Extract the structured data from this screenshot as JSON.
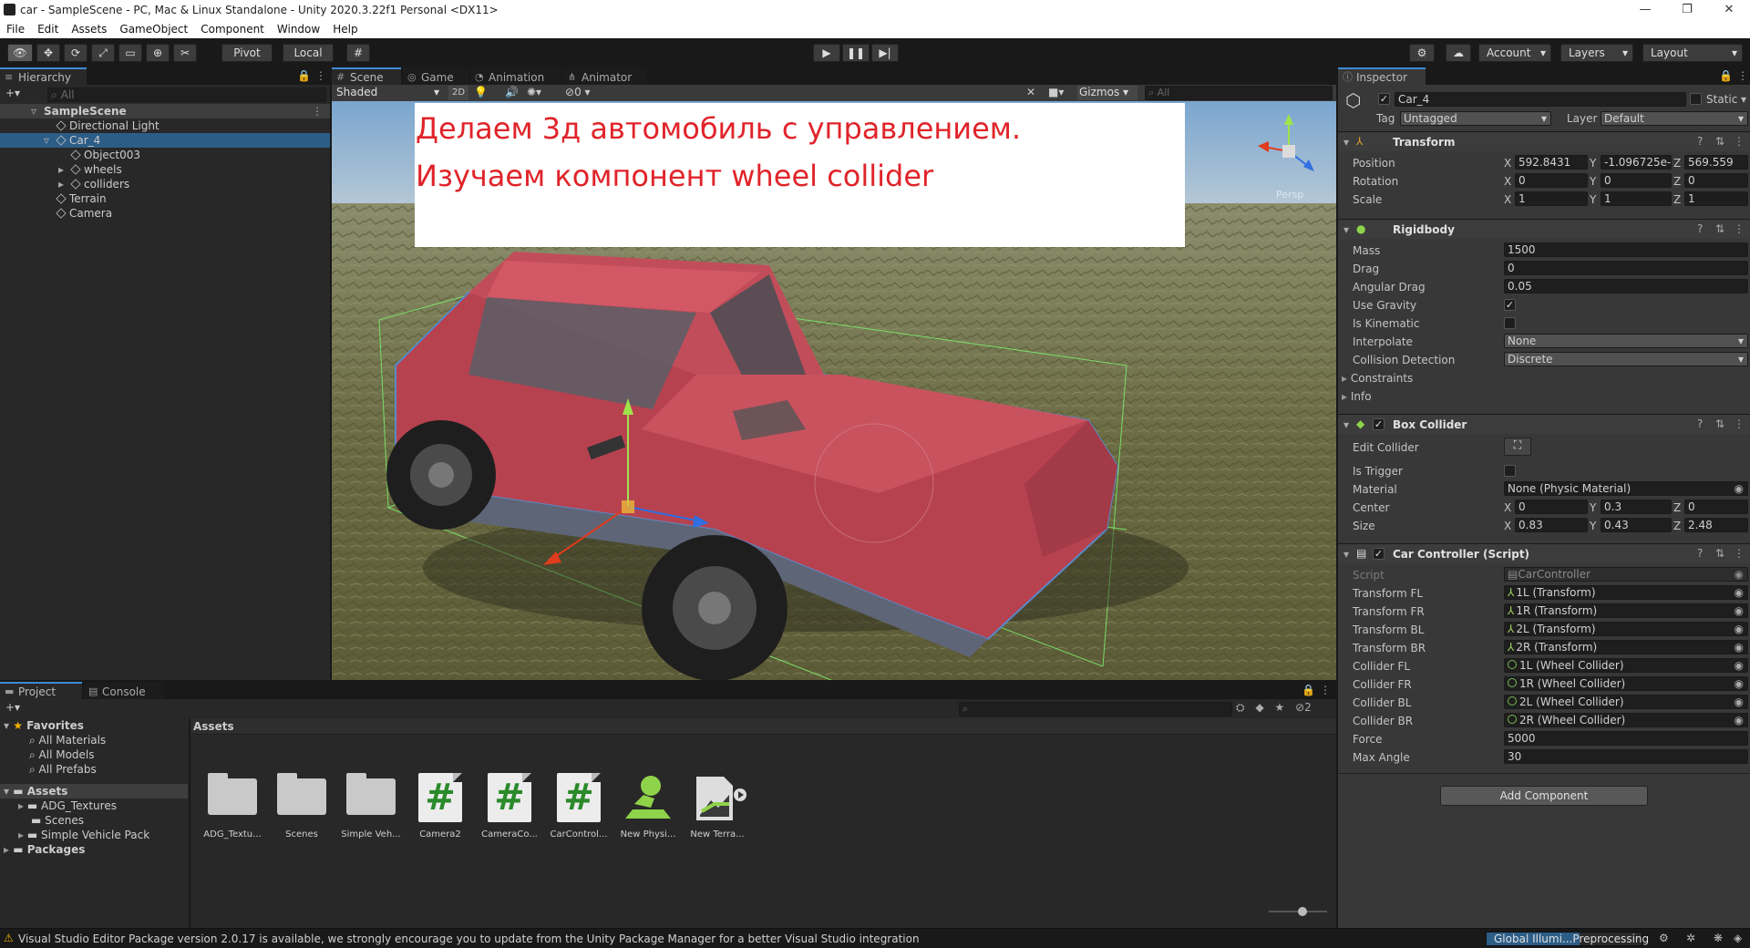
{
  "window": {
    "title": "car - SampleScene - PC, Mac & Linux Standalone - Unity 2020.3.22f1 Personal <DX11>",
    "min": "—",
    "max": "❐",
    "close": "✕"
  },
  "menu": [
    "File",
    "Edit",
    "Assets",
    "GameObject",
    "Component",
    "Window",
    "Help"
  ],
  "toolbar": {
    "pivot": "Pivot",
    "local": "Local",
    "account": "Account",
    "layers": "Layers",
    "layout": "Layout"
  },
  "hierarchy": {
    "tab": "Hierarchy",
    "search_placeholder": "All",
    "add": "+▾",
    "rows": [
      {
        "label": "SampleScene",
        "indent": 0,
        "type": "scene"
      },
      {
        "label": "Directional Light",
        "indent": 1,
        "type": "obj"
      },
      {
        "label": "Car_4",
        "indent": 1,
        "type": "obj"
      },
      {
        "label": "Object003",
        "indent": 2,
        "type": "obj"
      },
      {
        "label": "wheels",
        "indent": 2,
        "type": "obj"
      },
      {
        "label": "colliders",
        "indent": 2,
        "type": "obj"
      },
      {
        "label": "Terrain",
        "indent": 1,
        "type": "obj"
      },
      {
        "label": "Camera",
        "indent": 1,
        "type": "obj"
      }
    ]
  },
  "scene": {
    "tabs": [
      "Scene",
      "Game",
      "Animation",
      "Animator"
    ],
    "shading": "Shaded",
    "mode2d": "2D",
    "fx_count": "0",
    "gizmos": "Gizmos",
    "search_placeholder": "All",
    "persp": "Persp",
    "overlay_line1": "Делаем 3д автомобиль с управлением.",
    "overlay_line2": "Изучаем компонент wheel collider",
    "colors": {
      "sky": "#8fb7d8",
      "ground": "#6f7048",
      "car": "#c44a58",
      "overlay_text": "#e0242a"
    }
  },
  "project": {
    "tabs": [
      "Project",
      "Console"
    ],
    "hidden_count": "2",
    "favorites": {
      "title": "Favorites",
      "items": [
        "All Materials",
        "All Models",
        "All Prefabs"
      ]
    },
    "assets_tree": {
      "title": "Assets",
      "items": [
        "ADG_Textures",
        "Scenes",
        "Simple Vehicle Pack"
      ]
    },
    "packages": "Packages",
    "breadcrumb": "Assets",
    "assets": [
      {
        "name": "ADG_Textu...",
        "kind": "folder"
      },
      {
        "name": "Scenes",
        "kind": "folder"
      },
      {
        "name": "Simple Veh...",
        "kind": "folder"
      },
      {
        "name": "Camera2",
        "kind": "script"
      },
      {
        "name": "CameraCo...",
        "kind": "script"
      },
      {
        "name": "CarControl...",
        "kind": "script"
      },
      {
        "name": "New Physi...",
        "kind": "physic"
      },
      {
        "name": "New Terra...",
        "kind": "terrain"
      }
    ]
  },
  "inspector": {
    "tab": "Inspector",
    "object_name": "Car_4",
    "static": "Static",
    "tag_label": "Tag",
    "tag": "Untagged",
    "layer_label": "Layer",
    "layer": "Default",
    "transform": {
      "title": "Transform",
      "rows": [
        {
          "label": "Position",
          "x": "592.8431",
          "y": "-1.096725e-",
          "z": "569.559"
        },
        {
          "label": "Rotation",
          "x": "0",
          "y": "0",
          "z": "0"
        },
        {
          "label": "Scale",
          "x": "1",
          "y": "1",
          "z": "1"
        }
      ]
    },
    "rigidbody": {
      "title": "Rigidbody",
      "mass_label": "Mass",
      "mass": "1500",
      "drag_label": "Drag",
      "drag": "0",
      "adrag_label": "Angular Drag",
      "adrag": "0.05",
      "gravity_label": "Use Gravity",
      "kinematic_label": "Is Kinematic",
      "interp_label": "Interpolate",
      "interp": "None",
      "coll_label": "Collision Detection",
      "coll": "Discrete",
      "constraints": "Constraints",
      "info": "Info"
    },
    "box": {
      "title": "Box Collider",
      "edit_label": "Edit Collider",
      "trigger_label": "Is Trigger",
      "material_label": "Material",
      "material": "None (Physic Material)",
      "center_label": "Center",
      "center": {
        "x": "0",
        "y": "0.3",
        "z": "0"
      },
      "size_label": "Size",
      "size": {
        "x": "0.83",
        "y": "0.43",
        "z": "2.48"
      }
    },
    "car": {
      "title": "Car Controller (Script)",
      "script_label": "Script",
      "script": "CarController",
      "refs": [
        {
          "label": "Transform FL",
          "value": "1L (Transform)",
          "kind": "t"
        },
        {
          "label": "Transform FR",
          "value": "1R (Transform)",
          "kind": "t"
        },
        {
          "label": "Transform BL",
          "value": "2L (Transform)",
          "kind": "t"
        },
        {
          "label": "Transform BR",
          "value": "2R (Transform)",
          "kind": "t"
        },
        {
          "label": "Collider FL",
          "value": "1L (Wheel Collider)",
          "kind": "w"
        },
        {
          "label": "Collider FR",
          "value": "1R (Wheel Collider)",
          "kind": "w"
        },
        {
          "label": "Collider BL",
          "value": "2L (Wheel Collider)",
          "kind": "w"
        },
        {
          "label": "Collider BR",
          "value": "2R (Wheel Collider)",
          "kind": "w"
        }
      ],
      "force_label": "Force",
      "force": "5000",
      "angle_label": "Max Angle",
      "angle": "30"
    },
    "add_component": "Add Component"
  },
  "status": {
    "message": "Visual Studio Editor Package version 2.0.17 is available, we strongly encourage you to update from the Unity Package Manager for a better Visual Studio integration",
    "progress_label": "Global Illumi...Preprocessing"
  }
}
